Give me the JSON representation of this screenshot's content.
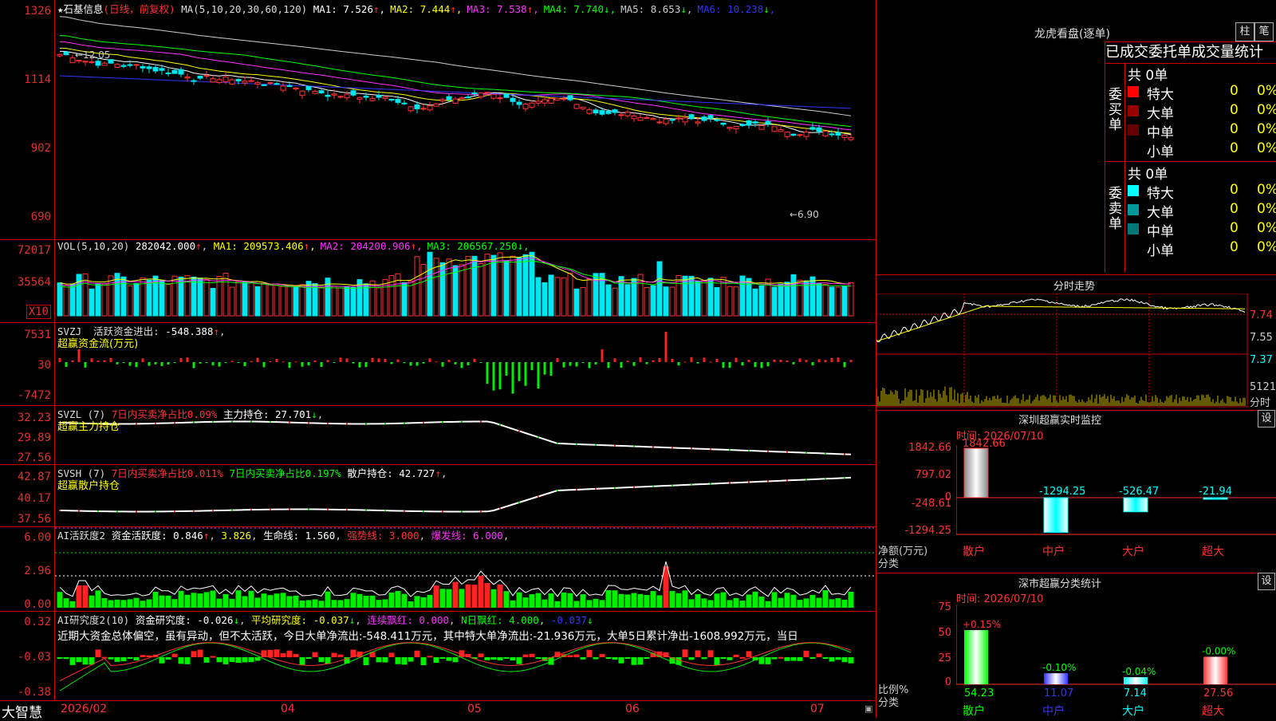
{
  "main": {
    "y_labels": [
      "1326",
      "1114",
      "902",
      "690"
    ],
    "stock_name": "石基信息",
    "period_tag": "(日线，前复权)",
    "ma_spec": "MA(5,10,20,30,60,120)",
    "ma": [
      {
        "label": "MA1:",
        "value": "7.526",
        "arrow": "↑",
        "color": "#ffffff"
      },
      {
        "label": "MA2:",
        "value": "7.444",
        "arrow": "↑",
        "color": "#ffff00"
      },
      {
        "label": "MA3:",
        "value": "7.538",
        "arrow": "↑",
        "color": "#ff33ff"
      },
      {
        "label": "MA4:",
        "value": "7.740",
        "arrow": "↓",
        "color": "#00ff00"
      },
      {
        "label": "MA5:",
        "value": "8.653",
        "arrow": "↓",
        "color": "#cccccc"
      },
      {
        "label": "MA6:",
        "value": "10.238",
        "arrow": "↓",
        "color": "#3333ff"
      }
    ],
    "high_marker": "←12.05",
    "low_marker": "←6.90"
  },
  "vol": {
    "y_labels": [
      "72017",
      "35564"
    ],
    "unit_tag": "X10",
    "spec": "VOL(5,10,20)",
    "value": "282042.000",
    "arrow": "↑",
    "ma": [
      {
        "label": "MA1:",
        "value": "209573.406",
        "arrow": "↑",
        "color": "#ffff00"
      },
      {
        "label": "MA2:",
        "value": "204200.906",
        "arrow": "↑",
        "color": "#ff33ff"
      },
      {
        "label": "MA3:",
        "value": "206567.250",
        "arrow": "↓",
        "color": "#00ff00"
      }
    ]
  },
  "svzj": {
    "y_labels": [
      "7531",
      "30",
      "-7472"
    ],
    "spec": "SVZJ",
    "label": "活跃资金进出:",
    "value": "-548.388",
    "arrow": "↑",
    "subtitle": "超赢资金流(万元)"
  },
  "svzl": {
    "y_labels": [
      "32.23",
      "29.89",
      "27.56"
    ],
    "spec": "SVZL (7)",
    "ratio_text": "7日内买卖净占比0.09%",
    "hold_label": "主力持仓:",
    "hold_value": "27.701",
    "arrow": "↓",
    "subtitle": "超赢主力持仓"
  },
  "svsh": {
    "y_labels": [
      "42.87",
      "40.17",
      "37.56"
    ],
    "spec": "SVSH (7)",
    "ratio_text1": "7日内买卖净占比0.011%",
    "ratio_text2": "7日内买卖净占比0.197%",
    "hold_label": "散户持仓:",
    "hold_value": "42.727",
    "arrow": "↑",
    "subtitle": "超赢散户持仓"
  },
  "ai_active": {
    "y_labels": [
      "6.00",
      "2.96",
      "0.00"
    ],
    "spec": "AI活跃度2",
    "act_label": "资金活跃度:",
    "act_value": "0.846",
    "v2": "3.826",
    "life_label": "生命线:",
    "life_value": "1.560",
    "strong_text": "强势线: 3.000",
    "burst_text": "爆发线: 6.000"
  },
  "ai_research": {
    "y_labels": [
      "0.32",
      "-0.03",
      "-0.38"
    ],
    "spec": "AI研究度2(10)",
    "res_label": "资金研究度:",
    "res_value": "-0.026",
    "avg_text": "平均研究度: -0.037",
    "red_text": "连续飘红: 0.000",
    "nred_text": "N日飘红: 4.000",
    "last_value": "-0.037",
    "comment": "近期大资金总体偏空，虽有异动，但不太活跃，今日大单净流出:-548.411万元，其中特大单净流出:-21.936万元，大单5日累计净出-1608.992万元，当日"
  },
  "bottom": {
    "brand": "大智慧",
    "dates": [
      "2026/02",
      "04",
      "05",
      "06",
      "07"
    ]
  },
  "lhb": {
    "title": "龙虎看盘(逐单)",
    "btn_zhu": "柱",
    "btn_bi": "笔",
    "header": "已成交委托单成交量统计",
    "buy_side": "委买单",
    "sell_side": "委卖单",
    "buy_total": "共 0单",
    "sell_total": "共 0单",
    "buy_rows": [
      {
        "name": "特大",
        "count": "0",
        "pct": "0%",
        "color": "#ff0000"
      },
      {
        "name": "大单",
        "count": "0",
        "pct": "0%",
        "color": "#990000"
      },
      {
        "name": "中单",
        "count": "0",
        "pct": "0%",
        "color": "#660000"
      },
      {
        "name": "小单",
        "count": "0",
        "pct": "0%",
        "color": ""
      }
    ],
    "sell_rows": [
      {
        "name": "特大",
        "count": "0",
        "pct": "0%",
        "color": "#00ffff"
      },
      {
        "name": "大单",
        "count": "0",
        "pct": "0%",
        "color": "#009999"
      },
      {
        "name": "中单",
        "count": "0",
        "pct": "0%",
        "color": "#007777"
      },
      {
        "name": "小单",
        "count": "0",
        "pct": "0%",
        "color": ""
      }
    ]
  },
  "intraday": {
    "title": "分时走势",
    "prices": [
      "7.74",
      "7.55",
      "7.37"
    ],
    "vol_label": "5121",
    "unit": "分时"
  },
  "monitor": {
    "title": "深圳超赢实时监控",
    "btn": "设",
    "time": "时间: 2026/07/10",
    "y_labels": [
      "1842.66",
      "797.02",
      "0",
      "-248.61",
      "-1294.25"
    ],
    "axis_title1": "净额(万元)",
    "axis_title2": "分类",
    "bars": [
      {
        "name": "散户",
        "label": "1842.66",
        "value": 1842.66
      },
      {
        "name": "中户",
        "label": "-1294.25",
        "value": -1294.25
      },
      {
        "name": "大户",
        "label": "-526.47",
        "value": -526.47
      },
      {
        "name": "超大",
        "label": "-21.94",
        "value": -21.94
      }
    ]
  },
  "classify": {
    "title": "深市超赢分类统计",
    "btn": "设",
    "time": "时间: 2026/07/10",
    "y_labels": [
      "75",
      "50",
      "25",
      "0"
    ],
    "axis_title1": "比例%",
    "axis_title2": "分类",
    "bars": [
      {
        "name": "散户",
        "top": "+0.15%",
        "bottom": "54.23",
        "value": 54.23,
        "color": "#00ff00"
      },
      {
        "name": "中户",
        "top": "-0.10%",
        "bottom": "11.07",
        "value": 11.07,
        "color": "#3333ff"
      },
      {
        "name": "大户",
        "top": "-0.04%",
        "bottom": "7.14",
        "value": 7.14,
        "color": "#00ffff"
      },
      {
        "name": "超大",
        "top": "-0.00%",
        "bottom": "27.56",
        "value": 27.56,
        "color": "#ff3333"
      }
    ]
  }
}
